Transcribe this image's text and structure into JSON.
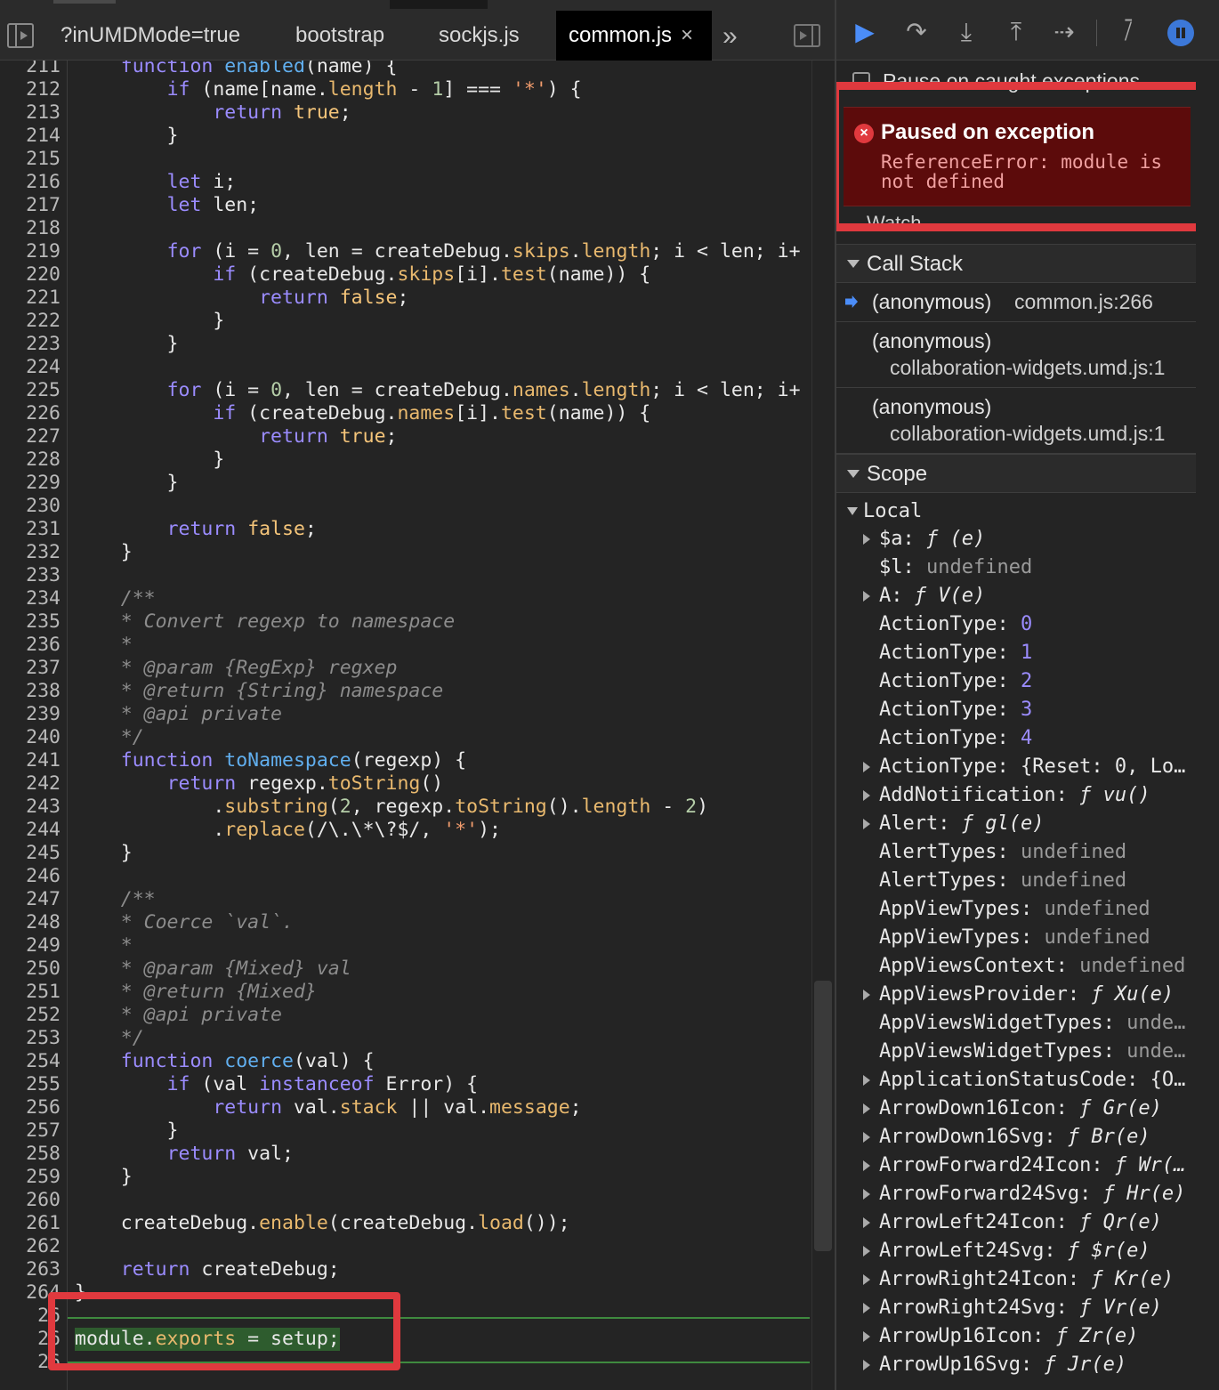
{
  "tabs": [
    {
      "label": "?inUMDMode=true",
      "active": false
    },
    {
      "label": "bootstrap",
      "active": false
    },
    {
      "label": "sockjs.js",
      "active": false
    },
    {
      "label": "common.js",
      "active": true
    }
  ],
  "tab_close_glyph": "×",
  "more_tabs_glyph": "»",
  "code": {
    "paused_line": 266,
    "lines": [
      {
        "n": "211",
        "t": "    function enabled(name) {"
      },
      {
        "n": "212",
        "t": "        if (name[name.length - 1] === '*') {"
      },
      {
        "n": "213",
        "t": "            return true;"
      },
      {
        "n": "214",
        "t": "        }"
      },
      {
        "n": "215",
        "t": ""
      },
      {
        "n": "216",
        "t": "        let i;"
      },
      {
        "n": "217",
        "t": "        let len;"
      },
      {
        "n": "218",
        "t": ""
      },
      {
        "n": "219",
        "t": "        for (i = 0, len = createDebug.skips.length; i < len; i+"
      },
      {
        "n": "220",
        "t": "            if (createDebug.skips[i].test(name)) {"
      },
      {
        "n": "221",
        "t": "                return false;"
      },
      {
        "n": "222",
        "t": "            }"
      },
      {
        "n": "223",
        "t": "        }"
      },
      {
        "n": "224",
        "t": ""
      },
      {
        "n": "225",
        "t": "        for (i = 0, len = createDebug.names.length; i < len; i+"
      },
      {
        "n": "226",
        "t": "            if (createDebug.names[i].test(name)) {"
      },
      {
        "n": "227",
        "t": "                return true;"
      },
      {
        "n": "228",
        "t": "            }"
      },
      {
        "n": "229",
        "t": "        }"
      },
      {
        "n": "230",
        "t": ""
      },
      {
        "n": "231",
        "t": "        return false;"
      },
      {
        "n": "232",
        "t": "    }"
      },
      {
        "n": "233",
        "t": ""
      },
      {
        "n": "234",
        "t": "    /**"
      },
      {
        "n": "235",
        "t": "    * Convert regexp to namespace"
      },
      {
        "n": "236",
        "t": "    *"
      },
      {
        "n": "237",
        "t": "    * @param {RegExp} regxep"
      },
      {
        "n": "238",
        "t": "    * @return {String} namespace"
      },
      {
        "n": "239",
        "t": "    * @api private"
      },
      {
        "n": "240",
        "t": "    */"
      },
      {
        "n": "241",
        "t": "    function toNamespace(regexp) {"
      },
      {
        "n": "242",
        "t": "        return regexp.toString()"
      },
      {
        "n": "243",
        "t": "            .substring(2, regexp.toString().length - 2)"
      },
      {
        "n": "244",
        "t": "            .replace(/\\.\\*\\?$/, '*');"
      },
      {
        "n": "245",
        "t": "    }"
      },
      {
        "n": "246",
        "t": ""
      },
      {
        "n": "247",
        "t": "    /**"
      },
      {
        "n": "248",
        "t": "    * Coerce `val`."
      },
      {
        "n": "249",
        "t": "    *"
      },
      {
        "n": "250",
        "t": "    * @param {Mixed} val"
      },
      {
        "n": "251",
        "t": "    * @return {Mixed}"
      },
      {
        "n": "252",
        "t": "    * @api private"
      },
      {
        "n": "253",
        "t": "    */"
      },
      {
        "n": "254",
        "t": "    function coerce(val) {"
      },
      {
        "n": "255",
        "t": "        if (val instanceof Error) {"
      },
      {
        "n": "256",
        "t": "            return val.stack || val.message;"
      },
      {
        "n": "257",
        "t": "        }"
      },
      {
        "n": "258",
        "t": "        return val;"
      },
      {
        "n": "259",
        "t": "    }"
      },
      {
        "n": "260",
        "t": ""
      },
      {
        "n": "261",
        "t": "    createDebug.enable(createDebug.load());"
      },
      {
        "n": "262",
        "t": ""
      },
      {
        "n": "263",
        "t": "    return createDebug;"
      },
      {
        "n": "264",
        "t": "}"
      },
      {
        "n": "26",
        "t": ""
      },
      {
        "n": "26",
        "t": "module.exports = setup;"
      },
      {
        "n": "26",
        "t": ""
      }
    ]
  },
  "debugger": {
    "pause_on_caught_label": "Pause on caught exceptions",
    "paused": {
      "title": "Paused on exception",
      "message": "ReferenceError: module is not defined"
    },
    "watch_label": "Watch",
    "call_stack": {
      "label": "Call Stack",
      "frames": [
        {
          "fn": "(anonymous)",
          "loc": "common.js:266",
          "current": true
        },
        {
          "fn": "(anonymous)",
          "loc": "collaboration-widgets.umd.js:1",
          "current": false
        },
        {
          "fn": "(anonymous)",
          "loc": "collaboration-widgets.umd.js:1",
          "current": false
        }
      ]
    },
    "scope": {
      "label": "Scope",
      "local_label": "Local",
      "vars": [
        {
          "name": "$a",
          "value": "ƒ (e)",
          "kind": "f",
          "expandable": true
        },
        {
          "name": "$l",
          "value": "undefined",
          "kind": "u",
          "expandable": false
        },
        {
          "name": "A",
          "value": "ƒ V(e)",
          "kind": "f",
          "expandable": true
        },
        {
          "name": "ActionType",
          "value": "0",
          "kind": "n",
          "expandable": false
        },
        {
          "name": "ActionType",
          "value": "1",
          "kind": "n",
          "expandable": false
        },
        {
          "name": "ActionType",
          "value": "2",
          "kind": "n",
          "expandable": false
        },
        {
          "name": "ActionType",
          "value": "3",
          "kind": "n",
          "expandable": false
        },
        {
          "name": "ActionType",
          "value": "4",
          "kind": "n",
          "expandable": false
        },
        {
          "name": "ActionType",
          "value": "{Reset: 0, Lo…",
          "kind": "o",
          "expandable": true
        },
        {
          "name": "AddNotification",
          "value": "ƒ vu()",
          "kind": "f",
          "expandable": true
        },
        {
          "name": "Alert",
          "value": "ƒ gl(e)",
          "kind": "f",
          "expandable": true
        },
        {
          "name": "AlertTypes",
          "value": "undefined",
          "kind": "u",
          "expandable": false
        },
        {
          "name": "AlertTypes",
          "value": "undefined",
          "kind": "u",
          "expandable": false
        },
        {
          "name": "AppViewTypes",
          "value": "undefined",
          "kind": "u",
          "expandable": false
        },
        {
          "name": "AppViewTypes",
          "value": "undefined",
          "kind": "u",
          "expandable": false
        },
        {
          "name": "AppViewsContext",
          "value": "undefined",
          "kind": "u",
          "expandable": false
        },
        {
          "name": "AppViewsProvider",
          "value": "ƒ Xu(e)",
          "kind": "f",
          "expandable": true
        },
        {
          "name": "AppViewsWidgetTypes",
          "value": "unde…",
          "kind": "u",
          "expandable": false
        },
        {
          "name": "AppViewsWidgetTypes",
          "value": "unde…",
          "kind": "u",
          "expandable": false
        },
        {
          "name": "ApplicationStatusCode",
          "value": "{O…",
          "kind": "o",
          "expandable": true
        },
        {
          "name": "ArrowDown16Icon",
          "value": "ƒ Gr(e)",
          "kind": "f",
          "expandable": true
        },
        {
          "name": "ArrowDown16Svg",
          "value": "ƒ Br(e)",
          "kind": "f",
          "expandable": true
        },
        {
          "name": "ArrowForward24Icon",
          "value": "ƒ Wr(…",
          "kind": "f",
          "expandable": true
        },
        {
          "name": "ArrowForward24Svg",
          "value": "ƒ Hr(e)",
          "kind": "f",
          "expandable": true
        },
        {
          "name": "ArrowLeft24Icon",
          "value": "ƒ Qr(e)",
          "kind": "f",
          "expandable": true
        },
        {
          "name": "ArrowLeft24Svg",
          "value": "ƒ $r(e)",
          "kind": "f",
          "expandable": true
        },
        {
          "name": "ArrowRight24Icon",
          "value": "ƒ Kr(e)",
          "kind": "f",
          "expandable": true
        },
        {
          "name": "ArrowRight24Svg",
          "value": "ƒ Vr(e)",
          "kind": "f",
          "expandable": true
        },
        {
          "name": "ArrowUp16Icon",
          "value": "ƒ Zr(e)",
          "kind": "f",
          "expandable": true
        },
        {
          "name": "ArrowUp16Svg",
          "value": "ƒ Jr(e)",
          "kind": "f",
          "expandable": true
        }
      ]
    }
  },
  "colors": {
    "highlight_box": "#e0393e",
    "paused_line_bg": "#2e5c2e",
    "exception_bg": "#5c0b0b",
    "accent": "#4b8df8"
  }
}
